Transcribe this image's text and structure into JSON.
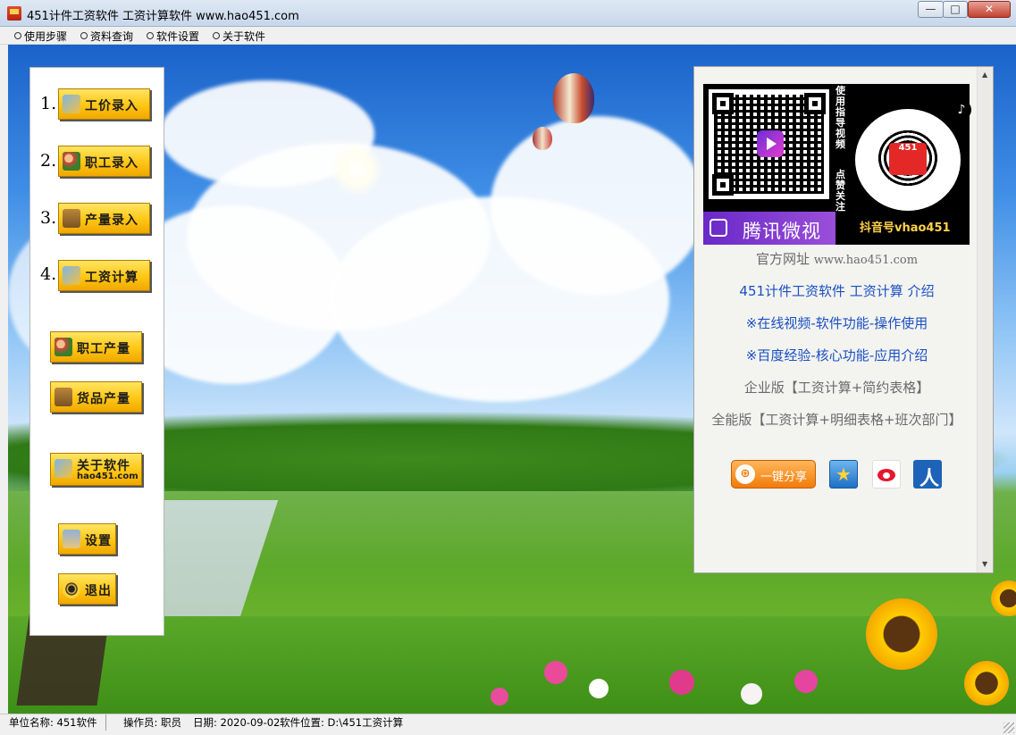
{
  "window": {
    "title": "451计件工资软件 工资计算软件 www.hao451.com",
    "controls": {
      "minimize": "—",
      "maximize": "□",
      "close": "✕"
    }
  },
  "menu": [
    {
      "label": "使用步骤"
    },
    {
      "label": "资料查询"
    },
    {
      "label": "软件设置"
    },
    {
      "label": "关于软件"
    }
  ],
  "left_panel": {
    "steps": [
      {
        "number": "1.",
        "label": "工价录入",
        "icon": "calculator-icon"
      },
      {
        "number": "2.",
        "label": "职工录入",
        "icon": "people-icon"
      },
      {
        "number": "3.",
        "label": "产量录入",
        "icon": "gift-box-icon"
      },
      {
        "number": "4.",
        "label": "工资计算",
        "icon": "calculator-icon"
      }
    ],
    "reports": [
      {
        "label": "职工产量",
        "icon": "people-icon"
      },
      {
        "label": "货品产量",
        "icon": "gift-box-icon"
      }
    ],
    "about": {
      "label": "关于软件",
      "sub": "hao451.com",
      "icon": "calculator-icon"
    },
    "settings": {
      "label": "设置",
      "icon": "settings-icon"
    },
    "exit": {
      "label": "退出",
      "icon": "power-icon"
    }
  },
  "right_panel": {
    "qr": {
      "weishi_brand": "腾讯微视",
      "vertical_note_top": "使用指导视频",
      "vertical_note_bottom": "点赞关注",
      "douyin_badge": "451",
      "douyin_account": "抖音号vhao451"
    },
    "official_site_label": "官方网址",
    "official_site_url": "www.hao451.com",
    "link_intro": "451计件工资软件 工资计算 介绍",
    "link_video": "※在线视频-软件功能-操作使用",
    "link_baidu": "※百度经验-核心功能-应用介绍",
    "edition_enterprise": "企业版【工资计算+简约表格】",
    "edition_full": "全能版【工资计算+明细表格+班次部门】",
    "share_label": "一键分享",
    "share_icons": [
      "qzone-icon",
      "weibo-icon",
      "renren-icon"
    ],
    "colors": {
      "link": "#1a4fc4",
      "muted": "#6a6a6a"
    }
  },
  "statusbar": {
    "unit": "单位名称: 451软件",
    "operator": "操作员: 职员",
    "date": "日期: 2020-09-02",
    "location": "软件位置: D:\\451工资计算"
  }
}
